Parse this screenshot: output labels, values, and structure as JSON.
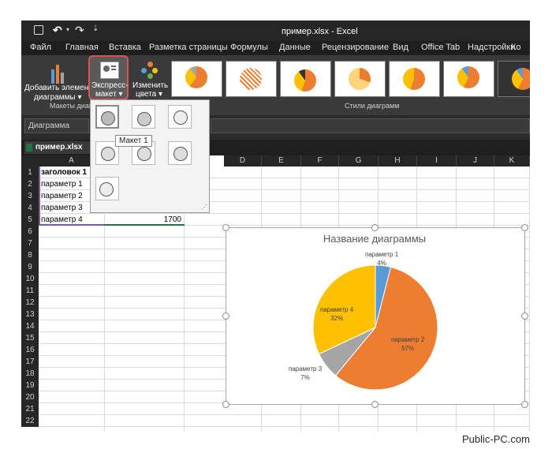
{
  "window": {
    "title": "пример.xlsx - Excel",
    "qat": {
      "undo_arrow": "▾"
    }
  },
  "menu_tabs": [
    "Файл",
    "Главная",
    "Вставка",
    "Разметка страницы",
    "Формулы",
    "Данные",
    "Рецензирование",
    "Вид",
    "Office Tab",
    "Надстройки",
    "Ко"
  ],
  "ribbon": {
    "add_element": "Добавить элемент",
    "add_element_sub": "диаграммы ▾",
    "express_layout": "Экспресс-",
    "express_layout_sub": "макет ▾",
    "change_colors": "Изменить",
    "change_colors_sub": "цвета ▾",
    "group_layouts": "Макеты диагр",
    "group_styles": "Стили диаграмм"
  },
  "name_box": "Диаграмма",
  "file_tab": "пример.xlsx",
  "tooltip": "Макет 1",
  "columns": [
    "A",
    "",
    "D",
    "E",
    "F",
    "G",
    "H",
    "I",
    "J",
    "K"
  ],
  "rows": [
    "1",
    "2",
    "3",
    "4",
    "5",
    "6",
    "7",
    "8",
    "9",
    "10",
    "11",
    "12",
    "13",
    "14",
    "15",
    "16",
    "17",
    "18",
    "19",
    "20",
    "21",
    "22"
  ],
  "table": {
    "header": "заголовок 1",
    "params": [
      "параметр 1",
      "параметр 2",
      "параметр 3",
      "параметр 4"
    ],
    "b5_value": "1700"
  },
  "chart_data": {
    "type": "pie",
    "title": "Название диаграммы",
    "categories": [
      "параметр 1",
      "параметр 2",
      "параметр 3",
      "параметр 4"
    ],
    "values": [
      4,
      57,
      7,
      32
    ],
    "data_labels": [
      "4%",
      "57%",
      "7%",
      "32%"
    ],
    "colors": [
      "#5b9bd5",
      "#ed7d31",
      "#a5a5a5",
      "#ffc000"
    ]
  },
  "watermark": "Public-PC.com",
  "colors": {
    "dark_bg": "#1f1f1f",
    "ribbon": "#3a3a3a",
    "accent_highlight": "#d9534f",
    "selection": "#217346"
  }
}
